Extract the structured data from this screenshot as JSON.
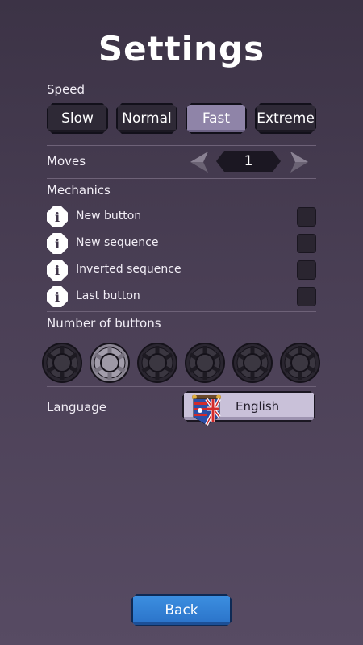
{
  "title": "Settings",
  "speed": {
    "label": "Speed",
    "options": [
      "Slow",
      "Normal",
      "Fast",
      "Extreme"
    ],
    "selected": "Fast"
  },
  "moves": {
    "label": "Moves",
    "value": "1"
  },
  "mechanics": {
    "label": "Mechanics",
    "items": [
      {
        "label": "New button",
        "checked": false
      },
      {
        "label": "New sequence",
        "checked": false
      },
      {
        "label": "Inverted sequence",
        "checked": false
      },
      {
        "label": "Last button",
        "checked": false
      }
    ]
  },
  "buttons": {
    "label": "Number of buttons",
    "count_options": 6,
    "selected_index": 1
  },
  "language": {
    "label": "Language",
    "value": "English",
    "flag_icon": "us-uk-flag-icon"
  },
  "back_label": "Back",
  "colors": {
    "accent_active": "#8f84a8",
    "back_button": "#2a72c8"
  }
}
